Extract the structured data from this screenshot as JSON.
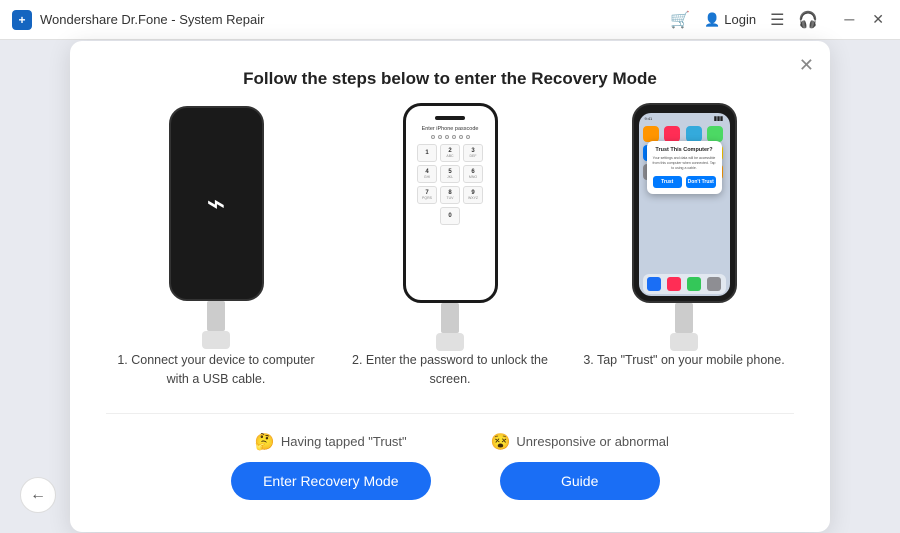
{
  "titlebar": {
    "title": "Wondershare Dr.Fone - System Repair",
    "login_label": "Login"
  },
  "dialog": {
    "title": "Follow the steps below to enter the Recovery Mode",
    "steps": [
      {
        "desc": "1. Connect your device to computer with a USB cable."
      },
      {
        "desc": "2. Enter the password to unlock the screen."
      },
      {
        "desc": "3. Tap \"Trust\" on your mobile phone."
      }
    ],
    "trust_label": "Having tapped \"Trust\"",
    "abnormal_label": "Unresponsive or abnormal",
    "enter_recovery_btn": "Enter Recovery Mode",
    "guide_btn": "Guide"
  },
  "passcode": {
    "label": "Enter iPhone passcode",
    "keys": [
      "1",
      "2",
      "3",
      "4",
      "5",
      "6",
      "7",
      "8",
      "9",
      "0"
    ]
  },
  "trust_dialog": {
    "title": "Trust This Computer?",
    "text": "Your settings and data will be accessible from this computer when connected. Tap to using a cable.",
    "trust": "Trust",
    "dont_trust": "Don't Trust"
  },
  "numpad_keys": [
    {
      "main": "1",
      "sub": ""
    },
    {
      "main": "2",
      "sub": "ABC"
    },
    {
      "main": "3",
      "sub": "DEF"
    },
    {
      "main": "4",
      "sub": "GHI"
    },
    {
      "main": "5",
      "sub": "JKL"
    },
    {
      "main": "6",
      "sub": "MNO"
    },
    {
      "main": "7",
      "sub": "PQRS"
    },
    {
      "main": "8",
      "sub": "TUV"
    },
    {
      "main": "9",
      "sub": "WXYZ"
    },
    {
      "main": "0",
      "sub": ""
    }
  ],
  "app_colors": [
    "#ff9500",
    "#ff2d55",
    "#34aadc",
    "#4cd964",
    "#007aff",
    "#5ac8fa",
    "#ff3b30",
    "#ffcc00",
    "#8e8e93",
    "#34c759",
    "#af52de",
    "#ff9f0a"
  ]
}
